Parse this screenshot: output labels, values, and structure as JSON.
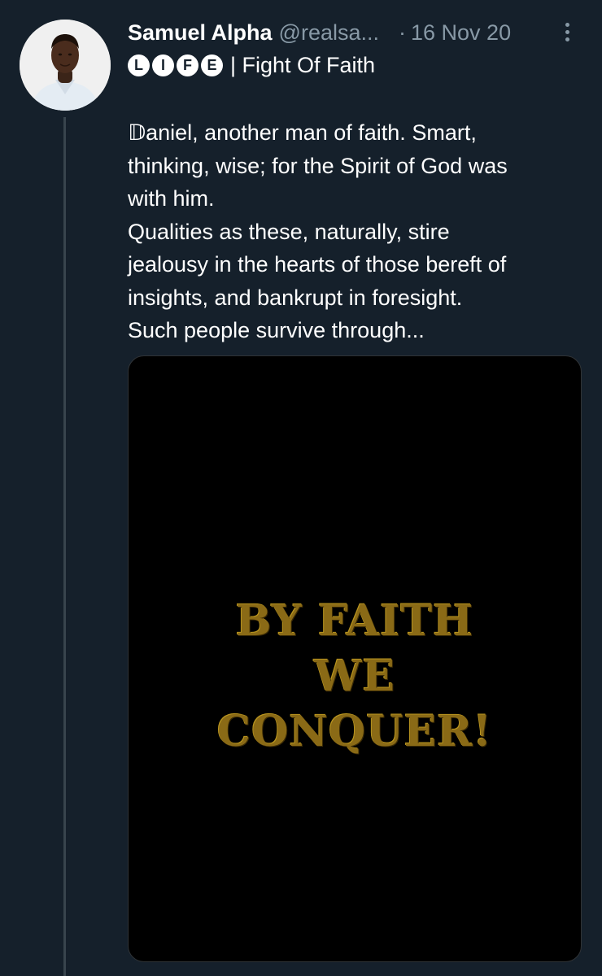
{
  "tweet": {
    "display_name": "Samuel Alpha",
    "handle": "@realsa...",
    "separator": "·",
    "date": "16 Nov 20",
    "more_icon": "more-vertical-icon",
    "badges": [
      "L",
      "I",
      "F",
      "E"
    ],
    "subtitle": "| Fight Of Faith",
    "text_lines": [
      "𝔻aniel, another man of faith. Smart,",
      "thinking, wise; for the Spirit of God was",
      "with him.",
      "Qualities as these, naturally, stire",
      "jealousy in the hearts of those bereft of",
      "insights, and bankrupt in foresight.",
      "Such people survive through..."
    ],
    "media": {
      "caption_lines": [
        "BY FAITH",
        "WE",
        "CONQUER!"
      ],
      "caption_color": "#8a6a16",
      "background": "#000000"
    }
  },
  "colors": {
    "background": "#15202b",
    "primary_text": "#ffffff",
    "secondary_text": "#8899a6",
    "thread_line": "#38444d"
  }
}
